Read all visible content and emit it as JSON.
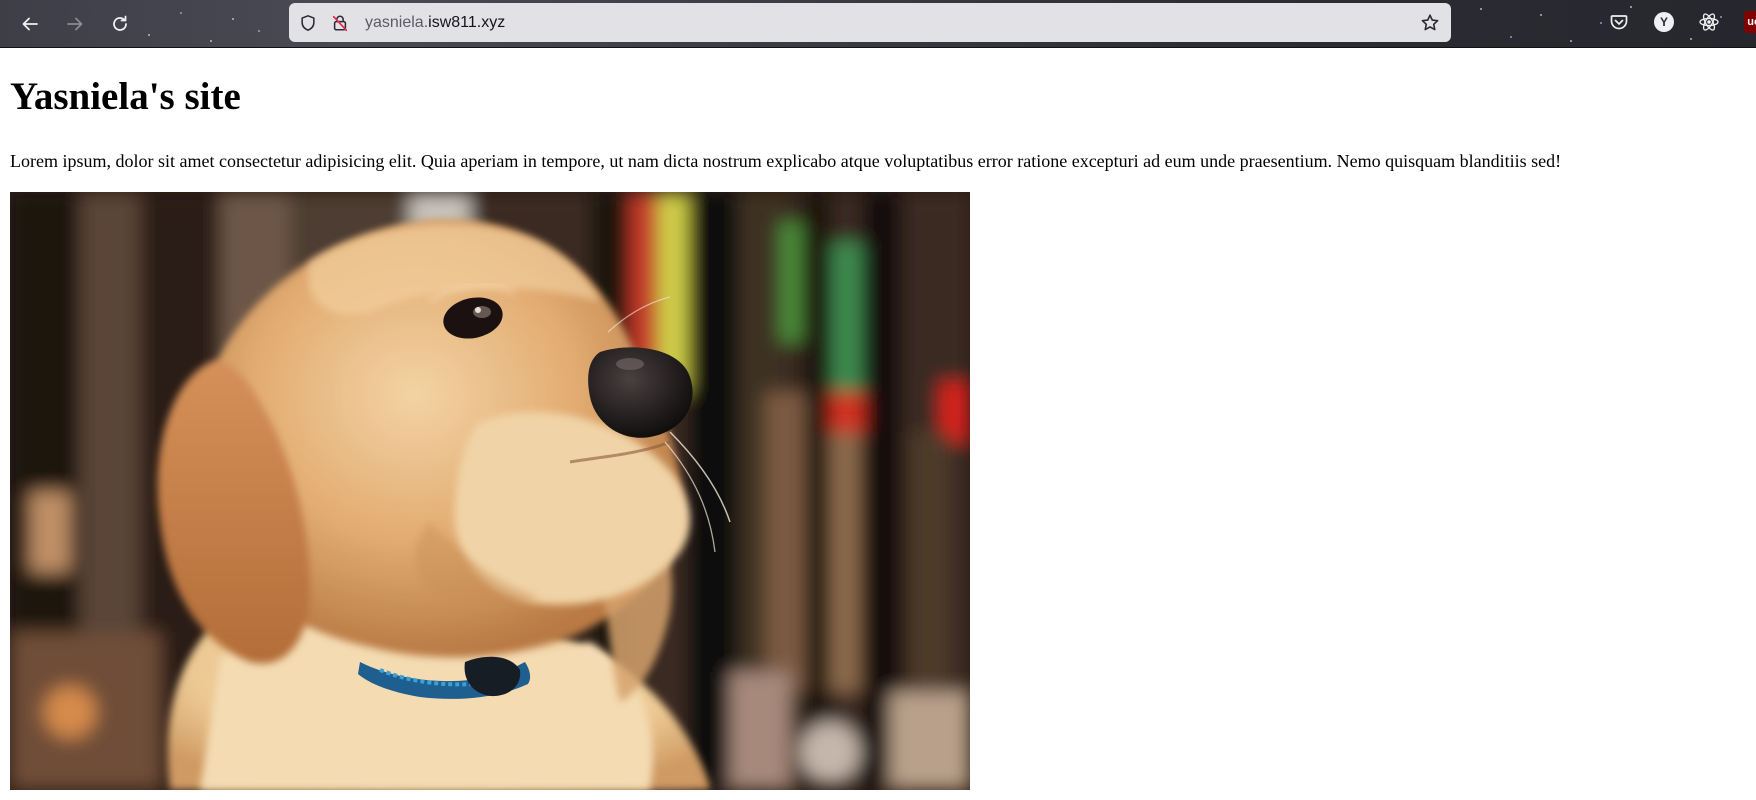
{
  "browser": {
    "url_prefix": "yasniela.",
    "url_domain": "isw811.xyz",
    "profile_initial": "Y",
    "extension_badge": "uo",
    "icons": {
      "back": "arrow-left-icon",
      "forward": "arrow-right-icon",
      "reload": "reload-icon",
      "tracking": "shield-icon",
      "insecure": "insecure-lock-icon",
      "bookmark": "star-icon",
      "pocket": "pocket-icon",
      "profile": "profile-avatar-icon",
      "react": "react-devtools-icon",
      "ublock": "ublock-icon"
    }
  },
  "page": {
    "title": "Yasniela's site",
    "intro": "Lorem ipsum, dolor sit amet consectetur adipisicing elit. Quia aperiam in tempore, ut nam dicta nostrum explicabo atque voluptatibus error ratione excepturi ad eum unde praesentium. Nemo quisquam blanditiis sed!",
    "image_subject": "golden retriever puppy wearing a blue collar"
  },
  "colors": {
    "toolbar": "#2e2e36",
    "urlbar": "#e2e2e6",
    "text": "#000000",
    "background": "#ffffff"
  }
}
